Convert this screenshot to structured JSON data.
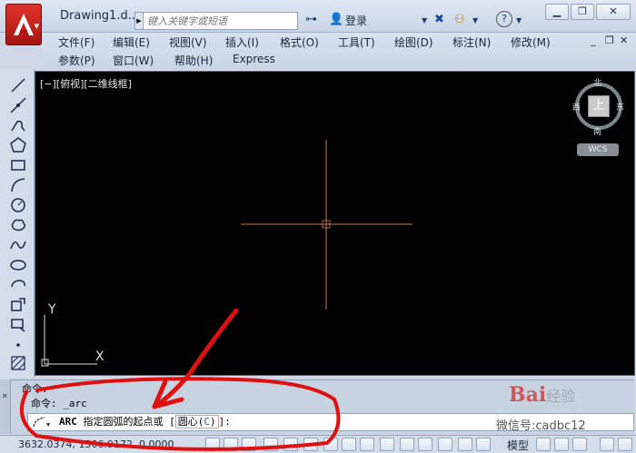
{
  "window": {
    "title": "Drawing1.d...",
    "search_placeholder": "键入关键字或短语",
    "login_label": "登录",
    "help_label": "?",
    "controls": {
      "minimize": "▁",
      "restore": "❐",
      "close": "✕",
      "doc_minimize": "_",
      "doc_restore": "❐",
      "doc_close": "✕"
    }
  },
  "menu": {
    "row1": [
      "文件(F)",
      "编辑(E)",
      "视图(V)",
      "插入(I)",
      "格式(O)",
      "工具(T)",
      "绘图(D)",
      "标注(N)",
      "修改(M)"
    ],
    "row2": [
      "参数(P)",
      "窗口(W)",
      "帮助(H)",
      "Express"
    ]
  },
  "viewport": {
    "label": "[−][俯视][二维线框]",
    "viewcube": {
      "north": "北",
      "south": "南",
      "east": "东",
      "west": "西",
      "face": "上",
      "wcs": "WCS"
    },
    "ucs": {
      "y_label": "Y",
      "x_label": "X"
    }
  },
  "command": {
    "side_label": "命令",
    "history_1": "命令:",
    "history_2": "命令: _arc",
    "prompt_name": "ARC",
    "prompt_text": "指定圆弧的起点或 [",
    "option_text": "圆心(",
    "option_key": "C",
    "option_close": ")",
    "prompt_end": "]:"
  },
  "status": {
    "coords": "3632.0374, 1506.9172, 0.0000",
    "model_label": "模型"
  },
  "watermark": {
    "logo": "Bai",
    "suffix": "经验",
    "handle": "微信号:cadbc12"
  },
  "colors": {
    "crosshair_red": "#c87a55",
    "annotation_red": "#e01010",
    "app_red": "#c4221b"
  }
}
